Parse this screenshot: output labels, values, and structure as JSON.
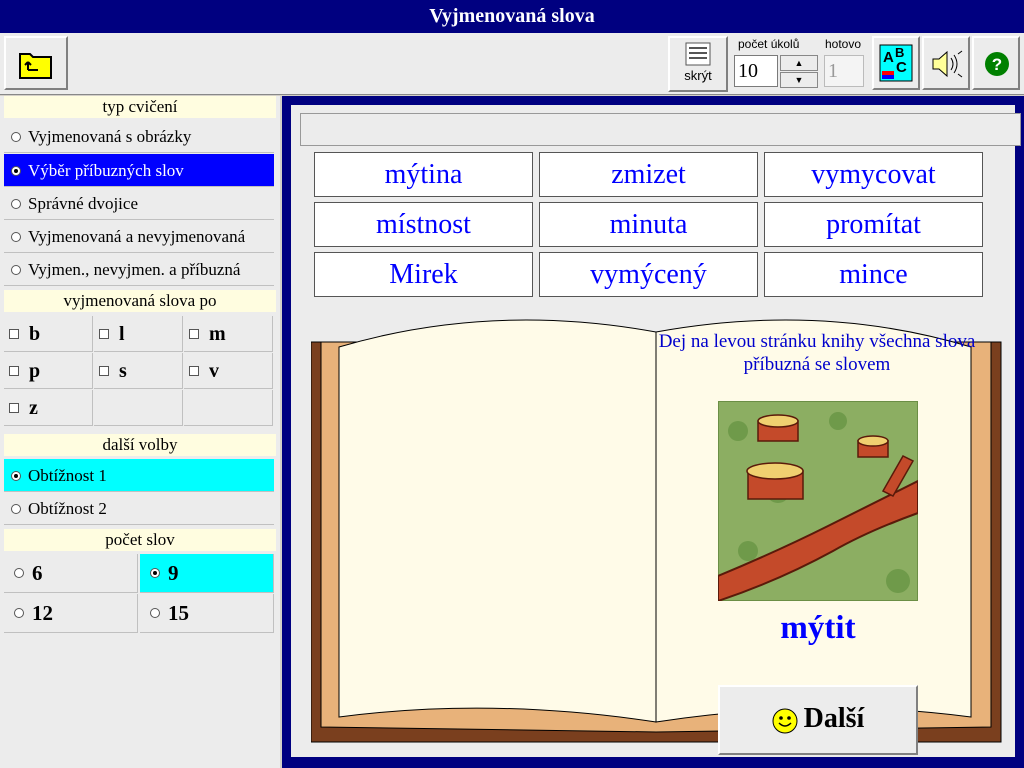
{
  "window": {
    "title": "Vyjmenovaná slova"
  },
  "toolbar": {
    "hide_label": "skrýt",
    "task_count_label": "počet úkolů",
    "task_count_value": "10",
    "done_label": "hotovo",
    "done_value": "1",
    "abc_icon": "spelling-abc-icon",
    "sound_icon": "speaker-icon",
    "help_icon": "help-icon"
  },
  "exercise_type": {
    "header": "typ cvičení",
    "items": [
      {
        "label": "Vyjmenovaná s obrázky",
        "selected": false
      },
      {
        "label": "Výběr příbuzných slov",
        "selected": true
      },
      {
        "label": "Správné dvojice",
        "selected": false
      },
      {
        "label": "Vyjmenovaná a nevyjmenovaná",
        "selected": false
      },
      {
        "label": "Vyjmen., nevyjmen. a příbuzná",
        "selected": false
      }
    ]
  },
  "letters": {
    "header": "vyjmenovaná slova po",
    "items": [
      "b",
      "l",
      "m",
      "p",
      "s",
      "v",
      "z"
    ]
  },
  "options": {
    "header": "další volby",
    "items": [
      {
        "label": "Obtížnost 1",
        "selected": true
      },
      {
        "label": "Obtížnost 2",
        "selected": false
      }
    ]
  },
  "word_count": {
    "header": "počet slov",
    "items": [
      {
        "label": "6",
        "selected": false
      },
      {
        "label": "9",
        "selected": true
      },
      {
        "label": "12",
        "selected": false
      },
      {
        "label": "15",
        "selected": false
      }
    ]
  },
  "words": [
    "mýtina",
    "zmizet",
    "vymycovat",
    "místnost",
    "minuta",
    "promítat",
    "Mirek",
    "vymýcený",
    "mince"
  ],
  "book": {
    "instruction": "Dej na levou stránku knihy všechna slova příbuzná se slovem",
    "target_word": "mýtit",
    "next_label": "Další"
  },
  "colors": {
    "title_bg": "#000080",
    "selection_blue": "#0000ff",
    "selection_cyan": "#00ffff",
    "word_color": "#0000ff",
    "book_cover": "#7a3f1e",
    "book_edge": "#e8b27a",
    "book_page": "#fffbe8"
  }
}
